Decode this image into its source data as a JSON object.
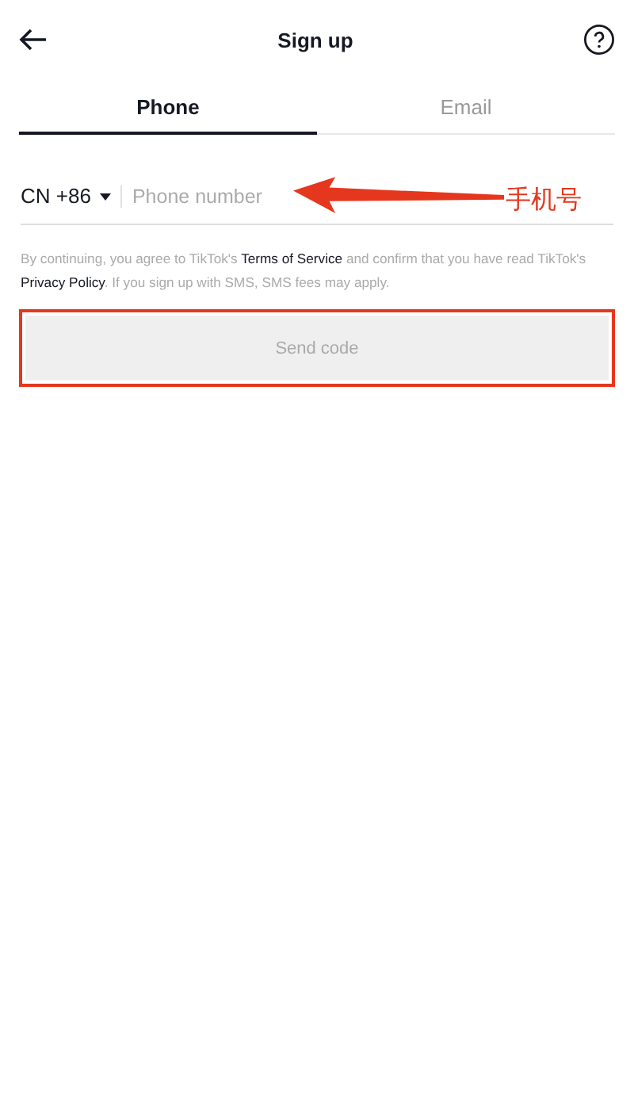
{
  "header": {
    "title": "Sign up"
  },
  "tabs": [
    {
      "label": "Phone",
      "selected": true
    },
    {
      "label": "Email",
      "selected": false
    }
  ],
  "phone": {
    "country_code": "CN +86",
    "placeholder": "Phone number"
  },
  "consent": [
    {
      "kind": "plain",
      "text": "By continuing, you agree to TikTok's "
    },
    {
      "kind": "link",
      "text": "Terms of Service"
    },
    {
      "kind": "plain",
      "text": " and confirm that you have read TikTok's "
    },
    {
      "kind": "link",
      "text": "Privacy Policy"
    },
    {
      "kind": "plain",
      "text": ". If you sign up with SMS, SMS fees may apply."
    }
  ],
  "send_button": {
    "label": "Send code",
    "disabled": true,
    "highlighted": true
  },
  "annotation": {
    "label": "手机号"
  }
}
